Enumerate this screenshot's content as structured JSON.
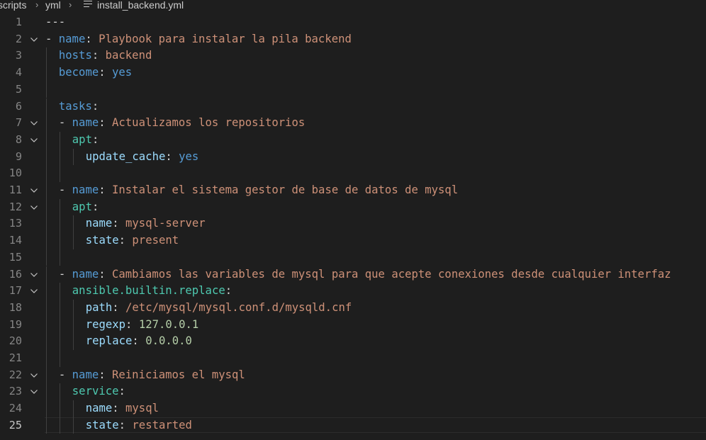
{
  "breadcrumb": {
    "items": [
      "scripts",
      "yml",
      "install_backend.yml"
    ],
    "icon": "file-lines-icon"
  },
  "editor": {
    "current_line": 25,
    "lines": [
      {
        "n": "1",
        "fold": false,
        "indent": 0,
        "tokens": [
          {
            "t": "doc",
            "v": "---"
          }
        ]
      },
      {
        "n": "2",
        "fold": true,
        "indent": 0,
        "tokens": [
          {
            "t": "dash",
            "v": "- "
          },
          {
            "t": "k1",
            "v": "name"
          },
          {
            "t": "punct",
            "v": ": "
          },
          {
            "t": "str",
            "v": "Playbook para instalar la pila backend"
          }
        ]
      },
      {
        "n": "3",
        "fold": false,
        "indent": 1,
        "tokens": [
          {
            "t": "k1",
            "v": "hosts"
          },
          {
            "t": "punct",
            "v": ": "
          },
          {
            "t": "str",
            "v": "backend"
          }
        ]
      },
      {
        "n": "4",
        "fold": false,
        "indent": 1,
        "tokens": [
          {
            "t": "k1",
            "v": "become"
          },
          {
            "t": "punct",
            "v": ": "
          },
          {
            "t": "bool",
            "v": "yes"
          }
        ]
      },
      {
        "n": "5",
        "fold": false,
        "indent": 1,
        "tokens": []
      },
      {
        "n": "6",
        "fold": false,
        "indent": 1,
        "tokens": [
          {
            "t": "k1",
            "v": "tasks"
          },
          {
            "t": "punct",
            "v": ":"
          }
        ]
      },
      {
        "n": "7",
        "fold": true,
        "indent": 1,
        "tokens": [
          {
            "t": "dash",
            "v": "- "
          },
          {
            "t": "k1",
            "v": "name"
          },
          {
            "t": "punct",
            "v": ": "
          },
          {
            "t": "str",
            "v": "Actualizamos los repositorios"
          }
        ]
      },
      {
        "n": "8",
        "fold": true,
        "indent": 2,
        "tokens": [
          {
            "t": "k2",
            "v": "apt"
          },
          {
            "t": "punct",
            "v": ":"
          }
        ]
      },
      {
        "n": "9",
        "fold": false,
        "indent": 3,
        "tokens": [
          {
            "t": "k3",
            "v": "update_cache"
          },
          {
            "t": "punct",
            "v": ": "
          },
          {
            "t": "bool",
            "v": "yes"
          }
        ]
      },
      {
        "n": "10",
        "fold": false,
        "indent": 2,
        "tokens": []
      },
      {
        "n": "11",
        "fold": true,
        "indent": 1,
        "tokens": [
          {
            "t": "dash",
            "v": "- "
          },
          {
            "t": "k1",
            "v": "name"
          },
          {
            "t": "punct",
            "v": ": "
          },
          {
            "t": "str",
            "v": "Instalar el sistema gestor de base de datos de mysql"
          }
        ]
      },
      {
        "n": "12",
        "fold": true,
        "indent": 2,
        "tokens": [
          {
            "t": "k2",
            "v": "apt"
          },
          {
            "t": "punct",
            "v": ":"
          }
        ]
      },
      {
        "n": "13",
        "fold": false,
        "indent": 3,
        "tokens": [
          {
            "t": "k3",
            "v": "name"
          },
          {
            "t": "punct",
            "v": ": "
          },
          {
            "t": "str",
            "v": "mysql-server"
          }
        ]
      },
      {
        "n": "14",
        "fold": false,
        "indent": 3,
        "tokens": [
          {
            "t": "k3",
            "v": "state"
          },
          {
            "t": "punct",
            "v": ": "
          },
          {
            "t": "str",
            "v": "present"
          }
        ]
      },
      {
        "n": "15",
        "fold": false,
        "indent": 2,
        "tokens": []
      },
      {
        "n": "16",
        "fold": true,
        "indent": 1,
        "tokens": [
          {
            "t": "dash",
            "v": "- "
          },
          {
            "t": "k1",
            "v": "name"
          },
          {
            "t": "punct",
            "v": ": "
          },
          {
            "t": "str",
            "v": "Cambiamos las variables de mysql para que acepte conexiones desde cualquier interfaz"
          }
        ]
      },
      {
        "n": "17",
        "fold": true,
        "indent": 2,
        "tokens": [
          {
            "t": "k2",
            "v": "ansible.builtin.replace"
          },
          {
            "t": "punct",
            "v": ":"
          }
        ]
      },
      {
        "n": "18",
        "fold": false,
        "indent": 3,
        "tokens": [
          {
            "t": "k3",
            "v": "path"
          },
          {
            "t": "punct",
            "v": ": "
          },
          {
            "t": "str",
            "v": "/etc/mysql/mysql.conf.d/mysqld.cnf"
          }
        ]
      },
      {
        "n": "19",
        "fold": false,
        "indent": 3,
        "tokens": [
          {
            "t": "k3",
            "v": "regexp"
          },
          {
            "t": "punct",
            "v": ": "
          },
          {
            "t": "num",
            "v": "127.0.0.1"
          }
        ]
      },
      {
        "n": "20",
        "fold": false,
        "indent": 3,
        "tokens": [
          {
            "t": "k3",
            "v": "replace"
          },
          {
            "t": "punct",
            "v": ": "
          },
          {
            "t": "num",
            "v": "0.0.0.0"
          }
        ]
      },
      {
        "n": "21",
        "fold": false,
        "indent": 2,
        "tokens": []
      },
      {
        "n": "22",
        "fold": true,
        "indent": 1,
        "tokens": [
          {
            "t": "dash",
            "v": "- "
          },
          {
            "t": "k1",
            "v": "name"
          },
          {
            "t": "punct",
            "v": ": "
          },
          {
            "t": "str",
            "v": "Reiniciamos el mysql"
          }
        ]
      },
      {
        "n": "23",
        "fold": true,
        "indent": 2,
        "tokens": [
          {
            "t": "k2",
            "v": "service"
          },
          {
            "t": "punct",
            "v": ":"
          }
        ]
      },
      {
        "n": "24",
        "fold": false,
        "indent": 3,
        "tokens": [
          {
            "t": "k3",
            "v": "name"
          },
          {
            "t": "punct",
            "v": ": "
          },
          {
            "t": "str",
            "v": "mysql"
          }
        ]
      },
      {
        "n": "25",
        "fold": false,
        "indent": 3,
        "tokens": [
          {
            "t": "k3",
            "v": "state"
          },
          {
            "t": "punct",
            "v": ": "
          },
          {
            "t": "str",
            "v": "restarted"
          }
        ]
      }
    ]
  },
  "colors": {
    "background": "#1e1e1e",
    "line_number": "#858585",
    "line_number_active": "#c6c6c6",
    "key_level1": "#569cd6",
    "key_level2": "#4ec9b0",
    "key_level3": "#9cdcfe",
    "string": "#ce9178",
    "number": "#b5cea8",
    "boolean": "#569cd6"
  }
}
